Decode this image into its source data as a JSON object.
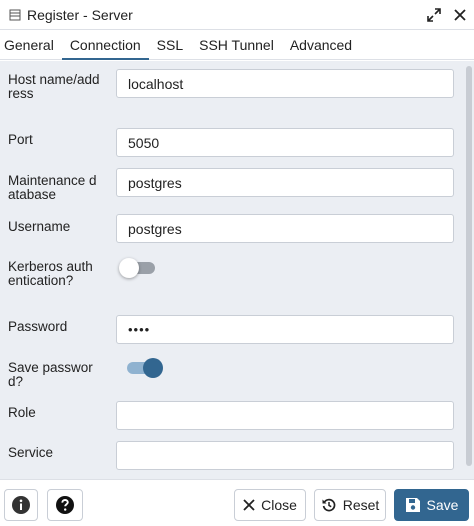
{
  "window": {
    "title": "Register - Server"
  },
  "tabs": [
    {
      "label": "General"
    },
    {
      "label": "Connection"
    },
    {
      "label": "SSL"
    },
    {
      "label": "SSH Tunnel"
    },
    {
      "label": "Advanced"
    }
  ],
  "form": {
    "host": {
      "label": "Host name/address",
      "value": "localhost"
    },
    "port": {
      "label": "Port",
      "value": "5050"
    },
    "maintenance_db": {
      "label": "Maintenance database",
      "value": "postgres"
    },
    "username": {
      "label": "Username",
      "value": "postgres"
    },
    "kerberos": {
      "label": "Kerberos authentication?",
      "enabled": false
    },
    "password": {
      "label": "Password",
      "value": "••••"
    },
    "save_password": {
      "label": "Save password?",
      "enabled": true
    },
    "role": {
      "label": "Role",
      "value": ""
    },
    "service": {
      "label": "Service",
      "value": ""
    }
  },
  "footer": {
    "close_label": "Close",
    "reset_label": "Reset",
    "save_label": "Save"
  },
  "colors": {
    "accent": "#326690",
    "panel_bg": "#ebeef3"
  }
}
